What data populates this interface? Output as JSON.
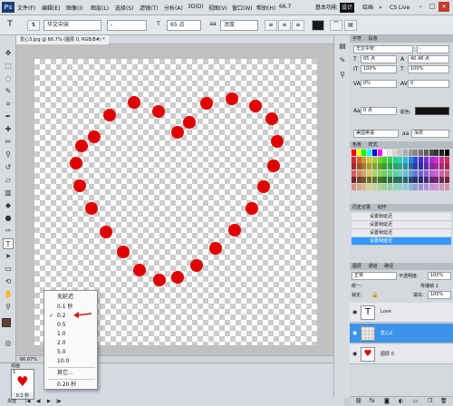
{
  "app": {
    "logo": "Ps"
  },
  "menus": [
    "文件(F)",
    "编辑(E)",
    "图像(I)",
    "图层(L)",
    "选择(S)",
    "滤镜(T)",
    "分析(A)",
    "3D(D)",
    "视图(V)",
    "窗口(W)",
    "帮助(H)"
  ],
  "menubar": {
    "zoom": "66.7",
    "workspaces": [
      "基本功能",
      "设计",
      "绘画"
    ],
    "more": "»",
    "cs_live": "CS Live"
  },
  "options": {
    "font_family": "华文中宋",
    "font_style": "-",
    "font_size": "65 点",
    "antialias": "浑厚"
  },
  "document": {
    "tab_title": "爱心3.jpg @ 66.7% (图层 0, RGB/8#) *"
  },
  "statusbar": {
    "zoom": "66.67%"
  },
  "delay_menu": {
    "items": [
      "无延迟",
      "0.1 秒",
      "0.2",
      "0.5",
      "1.0",
      "2.0",
      "5.0",
      "10.0",
      "其它...",
      "0.20 秒"
    ],
    "checked_index": 2
  },
  "timeline": {
    "tab": "动画",
    "frame_num": "1",
    "frame_delay": "0.2 秒",
    "loop": "永远"
  },
  "panels": {
    "character": {
      "tab1": "字符",
      "tab2": "段落",
      "font": "华文中宋",
      "size": "65 点",
      "leading": "40.48 点",
      "scale_v": "100%",
      "scale_h": "100%",
      "tracking": "0%",
      "kerning": "0",
      "baseline": "0 点",
      "color_label": "颜色:",
      "language": "美国英语",
      "aa": "浑厚"
    },
    "swatches": {
      "tab1": "色板",
      "tab2": "样式"
    },
    "history": {
      "tab1": "历史记录",
      "tab2": "动作",
      "items": [
        "设置帧延迟",
        "设置帧延迟",
        "设置帧延迟",
        "设置帧延迟"
      ]
    },
    "layers": {
      "tab1": "图层",
      "tab2": "通道",
      "tab3": "路径",
      "mode": "正常",
      "opacity_label": "不透明度:",
      "opacity": "100%",
      "unify_label": "统一:",
      "propagate": "传播帧 1",
      "lock_label": "锁定:",
      "fill_label": "填充:",
      "fill": "100%",
      "rows": [
        {
          "name": "Love",
          "thumb": "T"
        },
        {
          "name": "爱心2",
          "thumb": ""
        },
        {
          "name": "图层 0",
          "thumb": "♥"
        }
      ]
    }
  },
  "colors": {
    "heart": "#e00000",
    "accent": "#3b94e8"
  }
}
